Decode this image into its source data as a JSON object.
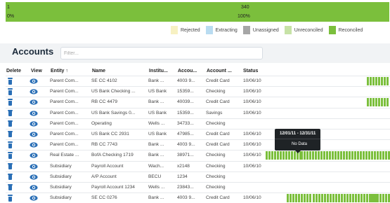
{
  "progress": {
    "start_label": "1",
    "start_pct": "0%",
    "end_label": "340",
    "end_pct": "100%",
    "fill_fraction": 1.0
  },
  "legend": [
    {
      "label": "Rejected",
      "color": "#f7f1c2"
    },
    {
      "label": "Extracting",
      "color": "#b9dcf1"
    },
    {
      "label": "Unassigned",
      "color": "#a6a6a6"
    },
    {
      "label": "Unreconciled",
      "color": "#c7e2a6"
    },
    {
      "label": "Reconciled",
      "color": "#7bbf3c"
    }
  ],
  "header": {
    "title": "Accounts",
    "filter_placeholder": "Filter..."
  },
  "columns": {
    "delete": "Delete",
    "view": "View",
    "entity": "Entity",
    "entity_sort_icon": "sort-up-arrow",
    "name": "Name",
    "institution": "Institu...",
    "account_number": "Accou...",
    "account_type": "Account ...",
    "status": "Status"
  },
  "rows": [
    {
      "entity": "Parent Com...",
      "name": "SE CC 4102",
      "institution": "Bank ...",
      "account_number": "4003 9...",
      "account_type": "Credit Card",
      "status": "10/06/10"
    },
    {
      "entity": "Parent Com...",
      "name": "US Bank Checking ...",
      "institution": "US Bank",
      "account_number": "15359...",
      "account_type": "Checking",
      "status": "10/06/10"
    },
    {
      "entity": "Parent Com...",
      "name": "RB CC 4479",
      "institution": "Bank ...",
      "account_number": "40039...",
      "account_type": "Credit Card",
      "status": "10/06/10"
    },
    {
      "entity": "Parent Com...",
      "name": "US Bank Savings 0...",
      "institution": "US Bank",
      "account_number": "15359...",
      "account_type": "Savings",
      "status": "10/06/10"
    },
    {
      "entity": "Parent Com...",
      "name": "Operating",
      "institution": "Wells ...",
      "account_number": "34733...",
      "account_type": "Checking",
      "status": ""
    },
    {
      "entity": "Parent Com...",
      "name": "US Bank CC 2931",
      "institution": "US Bank",
      "account_number": "47985...",
      "account_type": "Credit Card",
      "status": "10/06/10"
    },
    {
      "entity": "Parent Com...",
      "name": "RB CC 7743",
      "institution": "Bank ...",
      "account_number": "4003 9...",
      "account_type": "Credit Card",
      "status": "10/06/10"
    },
    {
      "entity": "Real Estate ...",
      "name": "BofA Checking 1719",
      "institution": "Bank ...",
      "account_number": "38971...",
      "account_type": "Checking",
      "status": "10/06/10"
    },
    {
      "entity": "Subsidiary",
      "name": "Payroll Account",
      "institution": "Wach...",
      "account_number": "x2148",
      "account_type": "Checking",
      "status": "10/06/10"
    },
    {
      "entity": "Subsidiary",
      "name": "A/P Account",
      "institution": "BECU",
      "account_number": "1234",
      "account_type": "Checking",
      "status": ""
    },
    {
      "entity": "Subsidiary",
      "name": "Payroll Account 1234",
      "institution": "Wells ...",
      "account_number": "23843...",
      "account_type": "Checking",
      "status": ""
    },
    {
      "entity": "Subsidiary",
      "name": "SE CC 0276",
      "institution": "Bank ...",
      "account_number": "4003 9...",
      "account_type": "Credit Card",
      "status": "10/06/10"
    }
  ],
  "tooltip": {
    "range": "12/01/11 - 12/31/11",
    "message": "No Data"
  },
  "colors": {
    "reconciled": "#7bbf3c",
    "icon_blue": "#2a6fb6"
  }
}
